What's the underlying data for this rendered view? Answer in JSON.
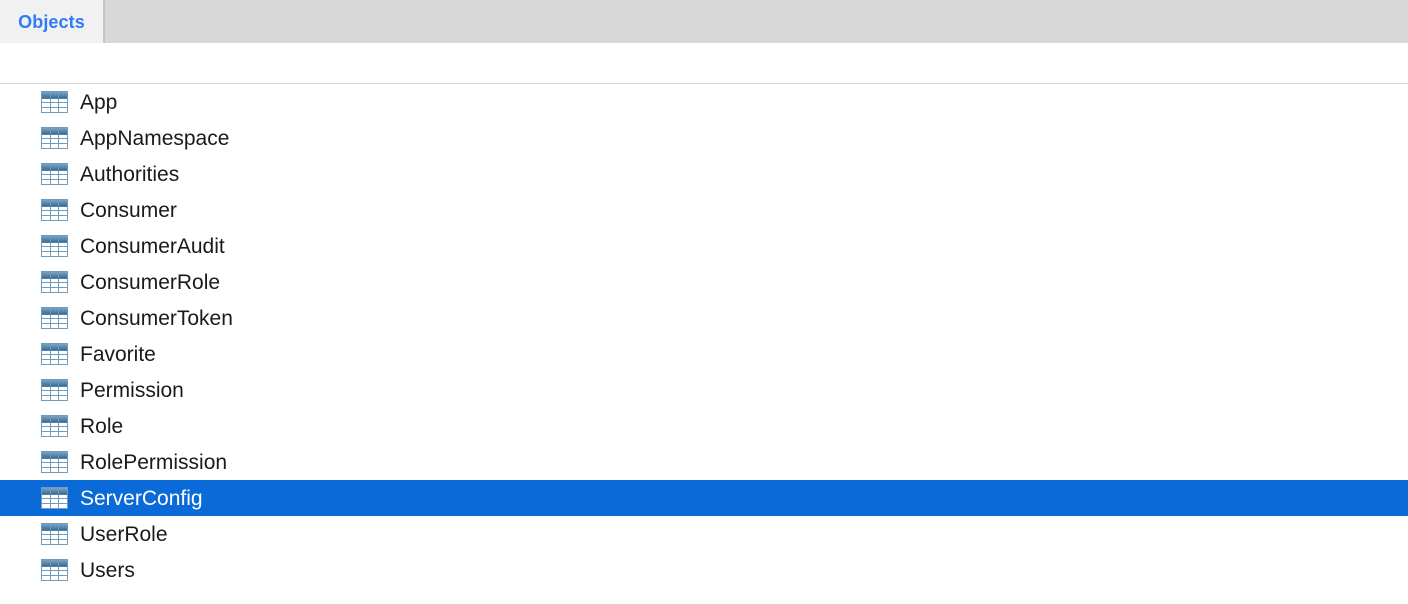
{
  "window": {
    "title": "Objects"
  },
  "tabbar": {
    "tabs": [
      {
        "label": "Objects",
        "active": true
      }
    ]
  },
  "colors": {
    "tabbar_background": "#d8d8d8",
    "active_tab_background": "#f1f1f1",
    "tab_text": "#2e7cf6",
    "selection_background": "#0a6ad8",
    "selection_text": "#ffffff",
    "list_background": "#ffffff",
    "row_text": "#1a1a1a",
    "separator": "#d4d4d4",
    "table_icon_header": "#4a7ea8",
    "table_icon_grid": "#6f9cbd"
  },
  "object_list": {
    "icon_name": "table-icon",
    "selected_index": 12,
    "rows": [
      {
        "label": "App",
        "icon": "table-icon",
        "selected": false
      },
      {
        "label": "AppNamespace",
        "icon": "table-icon",
        "selected": false
      },
      {
        "label": "Authorities",
        "icon": "table-icon",
        "selected": false
      },
      {
        "label": "Consumer",
        "icon": "table-icon",
        "selected": false
      },
      {
        "label": "ConsumerAudit",
        "icon": "table-icon",
        "selected": false
      },
      {
        "label": "ConsumerRole",
        "icon": "table-icon",
        "selected": false
      },
      {
        "label": "ConsumerToken",
        "icon": "table-icon",
        "selected": false
      },
      {
        "label": "Favorite",
        "icon": "table-icon",
        "selected": false
      },
      {
        "label": "Permission",
        "icon": "table-icon",
        "selected": false
      },
      {
        "label": "Role",
        "icon": "table-icon",
        "selected": false
      },
      {
        "label": "RolePermission",
        "icon": "table-icon",
        "selected": false
      },
      {
        "label": "ServerConfig",
        "icon": "table-icon",
        "selected": true
      },
      {
        "label": "UserRole",
        "icon": "table-icon",
        "selected": false
      },
      {
        "label": "Users",
        "icon": "table-icon",
        "selected": false
      }
    ]
  }
}
